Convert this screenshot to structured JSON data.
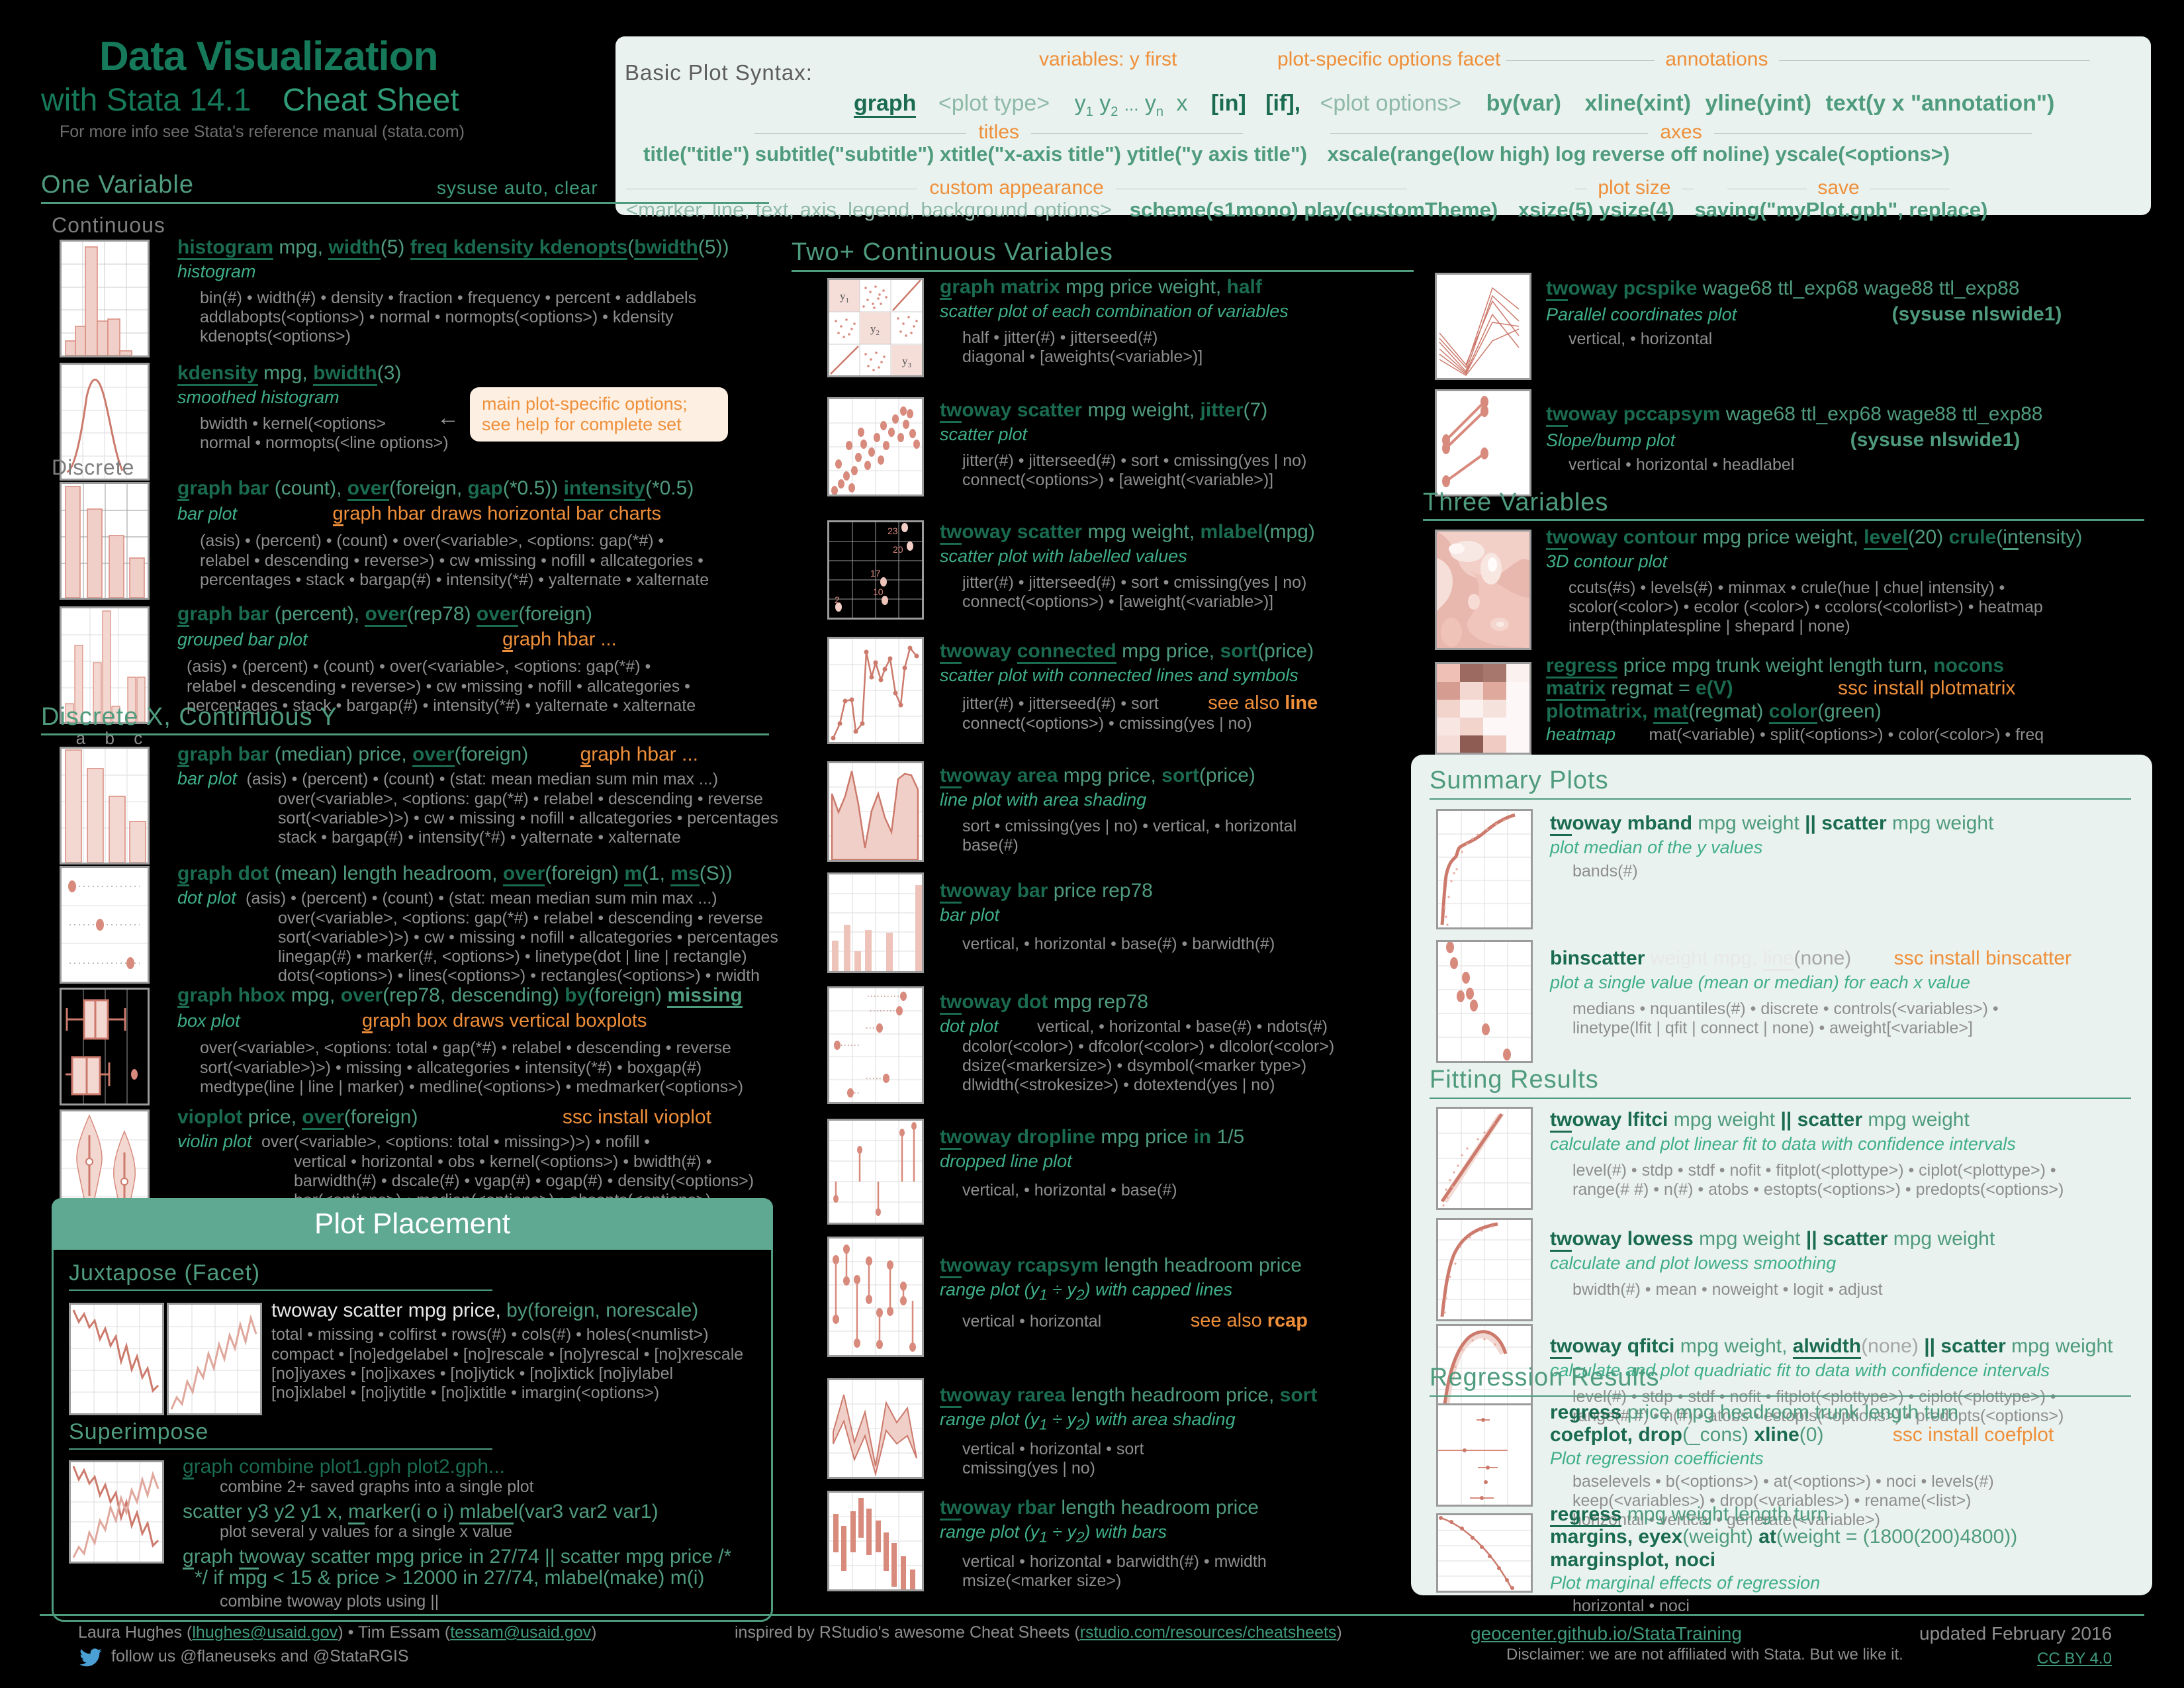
{
  "header": {
    "title": "Data Visualization",
    "subtitle_left": "with Stata 14.1",
    "subtitle_right": "Cheat Sheet",
    "note": "For more info see Stata's reference manual (stata.com)"
  },
  "syntax": {
    "label": "Basic Plot Syntax:",
    "tag_variables": "variables: y first",
    "tag_plot_opts": "plot-specific options",
    "tag_facet": "facet",
    "tag_annotations": "annotations",
    "tag_titles": "titles",
    "tag_axes": "axes",
    "tag_custom": "custom appearance",
    "tag_plotsize": "plot size",
    "tag_save": "save",
    "cmd_graph": "graph",
    "cmd_plottype": "<plot type>",
    "cmd_yvars": "y",
    "cmd_y1": "1",
    "cmd_y2": "2",
    "cmd_yn": "n",
    "cmd_x": "x",
    "cmd_in": "[in]",
    "cmd_if": "[if],",
    "cmd_plotoptions": "<plot options>",
    "cmd_by": "by(var)",
    "cmd_xline": "xline(xint)",
    "cmd_yline": "yline(yint)",
    "cmd_text": "text(y x \"annotation\")",
    "line_titles": "title(\"title\") subtitle(\"subtitle\") xtitle(\"x-axis title\") ytitle(\"y axis title\")",
    "line_axes": "xscale(range(low high) log reverse off noline) yscale(<options>)",
    "line_custom": "<marker, line, text, axis, legend, background options>",
    "line_custom2": "scheme(s1mono) play(customTheme)",
    "line_size": "xsize(5) ysize(4)",
    "line_save": "saving(\"myPlot.gph\", replace)"
  },
  "sections": {
    "one_variable": "One Variable",
    "one_variable_note": "sysuse auto, clear",
    "continuous": "Continuous",
    "discrete": "Discrete",
    "discrete_x_cont_y": "Discrete X, Continuous Y",
    "two_plus": "Two+ Continuous Variables",
    "three_variables": "Three Variables",
    "summary_plots": "Summary Plots",
    "fitting_results": "Fitting Results",
    "regression_results": "Regression Results",
    "plot_placement": "Plot Placement",
    "juxtapose": "Juxtapose (Facet)",
    "superimpose": "Superimpose"
  },
  "callout": {
    "line1": "main plot-specific options;",
    "line2": "see help for complete set"
  },
  "entries": {
    "histogram": {
      "cmd": "histogram mpg, width(5) freq kdensity kdenopts(bwidth(5))",
      "desc": "histogram",
      "opts": [
        "bin(#) • width(#) • density • fraction • frequency • percent • addlabels",
        "addlabopts(<options>) • normal • normopts(<options>) • kdensity",
        "kdenopts(<options>)"
      ]
    },
    "kdensity": {
      "cmd": "kdensity mpg, bwidth(3)",
      "desc": "smoothed histogram",
      "opts": [
        "bwidth • kernel(<options>",
        "normal • normopts(<line options>)"
      ]
    },
    "graph_bar_count": {
      "cmd": "graph bar (count), over(foreign, gap(*0.5)) intensity(*0.5)",
      "desc": "bar plot",
      "note": "graph hbar draws horizontal bar charts",
      "opts": [
        "(asis) • (percent) • (count) • over(<variable>, <options: gap(*#) •",
        "relabel • descending • reverse>) • cw •missing • nofill • allcategories •",
        "percentages • stack • bargap(#) • intensity(*#) • yalternate • xalternate"
      ]
    },
    "graph_bar_percent": {
      "cmd": "graph bar (percent), over(rep78) over(foreign)",
      "desc": "grouped bar plot",
      "note": "graph hbar ...",
      "opts": [
        "(asis) • (percent) • (count) • over(<variable>, <options: gap(*#) •",
        "relabel • descending • reverse>) • cw •missing • nofill • allcategories •",
        "percentages • stack • bargap(#) • intensity(*#) • yalternate • xalternate"
      ],
      "axis_labels": [
        "a",
        "b",
        "c"
      ]
    },
    "graph_bar_median": {
      "cmd": "graph bar (median) price, over(foreign)",
      "desc": "bar plot",
      "note": "graph hbar ...",
      "opts": [
        "(asis) • (percent) • (count) • (stat: mean median sum min max ...)",
        "over(<variable>, <options: gap(*#) • relabel • descending • reverse",
        "sort(<variable>)>) • cw • missing • nofill • allcategories • percentages",
        "stack • bargap(#) • intensity(*#) • yalternate • xalternate"
      ]
    },
    "graph_dot": {
      "cmd": "graph dot (mean) length headroom, over(foreign) m(1, ms(S))",
      "desc": "dot plot",
      "opts": [
        "(asis) • (percent) • (count) • (stat: mean median sum min max ...)",
        "over(<variable>, <options: gap(*#) • relabel • descending • reverse",
        "sort(<variable>)>) • cw • missing • nofill • allcategories • percentages",
        "linegap(#) • marker(#, <options>) • linetype(dot | line | rectangle)",
        "dots(<options>) • lines(<options>) • rectangles(<options>) • rwidth"
      ]
    },
    "graph_hbox": {
      "cmd": "graph hbox mpg, over(rep78, descending) by(foreign) missing",
      "desc": "box plot",
      "note": "graph box draws vertical boxplots",
      "opts": [
        "over(<variable>, <options: total • gap(*#) • relabel • descending • reverse",
        "sort(<variable>)>) • missing • allcategories • intensity(*#) • boxgap(#)",
        "medtype(line | line | marker) • medline(<options>) • medmarker(<options>)"
      ]
    },
    "vioplot": {
      "cmd": "vioplot price, over(foreign)",
      "desc": "violin plot",
      "note": "ssc install vioplot",
      "opts": [
        "over(<variable>, <options: total • missing>)>) • nofill •",
        "vertical • horizontal • obs • kernel(<options>) • bwidth(#) •",
        "barwidth(#) • dscale(#) • vgap(#) • ogap(#) • density(<options>)",
        "bar(<options>) • median(<options>) • obsopts(<options>)"
      ]
    },
    "graph_matrix": {
      "cmd": "graph matrix mpg price weight, half",
      "desc": "scatter plot of each combination of variables",
      "opts": [
        "half • jitter(#) • jitterseed(#)",
        "diagonal • [aweights(<variable>)]"
      ],
      "thumb_labels": [
        "y",
        "1",
        "y",
        "2",
        "y",
        "3"
      ]
    },
    "twoway_scatter": {
      "cmd": "twoway scatter mpg weight, jitter(7)",
      "desc": "scatter plot",
      "opts": [
        "jitter(#) • jitterseed(#) • sort • cmissing(yes | no)",
        "connect(<options>) • [aweight(<variable>)]"
      ]
    },
    "twoway_scatter_mlabel": {
      "cmd": "twoway scatter mpg weight, mlabel(mpg)",
      "desc": "scatter plot with labelled values",
      "opts": [
        "jitter(#) • jitterseed(#) • sort • cmissing(yes | no)",
        "connect(<options>) • [aweight(<variable>)]"
      ],
      "point_labels": [
        "23",
        "20",
        "17",
        "10",
        "2"
      ]
    },
    "twoway_connected": {
      "cmd": "twoway connected mpg price, sort(price)",
      "desc": "scatter plot with connected lines and symbols",
      "note": "see also line",
      "opts": [
        "jitter(#) • jitterseed(#) • sort",
        "connect(<options>) • cmissing(yes | no)"
      ]
    },
    "twoway_area": {
      "cmd": "twoway area mpg price, sort(price)",
      "desc": "line plot with area shading",
      "opts": [
        "sort • cmissing(yes | no) • vertical, • horizontal",
        "base(#)"
      ]
    },
    "twoway_bar": {
      "cmd": "twoway bar price rep78",
      "desc": "bar plot",
      "opts": [
        "vertical, • horizontal • base(#) • barwidth(#)"
      ]
    },
    "twoway_dot": {
      "cmd": "twoway dot mpg rep78",
      "desc": "dot plot",
      "opts": [
        "vertical, • horizontal • base(#) • ndots(#)",
        "dcolor(<color>) • dfcolor(<color>) • dlcolor(<color>)",
        "dsize(<markersize>) • dsymbol(<marker type>)",
        "dlwidth(<strokesize>) • dotextend(yes | no)"
      ]
    },
    "twoway_dropline": {
      "cmd": "twoway dropline mpg price in 1/5",
      "desc": "dropped line plot",
      "opts": [
        "vertical, • horizontal • base(#)"
      ]
    },
    "twoway_rcapsym": {
      "cmd": "twoway rcapsym length headroom price",
      "desc": "range plot (y1 ÷ y2) with capped lines",
      "note": "see also rcap",
      "opts": [
        "vertical • horizontal"
      ]
    },
    "twoway_rarea": {
      "cmd": "twoway rarea length headroom price, sort",
      "desc": "range plot (y1 ÷ y2) with area shading",
      "opts": [
        "vertical • horizontal • sort",
        "cmissing(yes | no)"
      ]
    },
    "twoway_rbar": {
      "cmd": "twoway rbar length headroom price",
      "desc": "range plot (y1 ÷ y2) with bars",
      "opts": [
        "vertical • horizontal • barwidth(#) • mwidth",
        "msize(<marker size>)"
      ]
    },
    "twoway_pcspike": {
      "cmd": "twoway pcspike wage68 ttl_exp68 wage88 ttl_exp88",
      "desc": "Parallel coordinates plot",
      "note": "(sysuse nlswide1)",
      "opts": [
        "vertical, • horizontal"
      ]
    },
    "twoway_pccapsym": {
      "cmd": "twoway pccapsym wage68 ttl_exp68 wage88 ttl_exp88",
      "desc": "Slope/bump plot",
      "note": "(sysuse nlswide1)",
      "opts": [
        "vertical • horizontal • headlabel"
      ]
    },
    "twoway_contour": {
      "cmd": "twoway contour mpg price weight, level(20) crule(intensity)",
      "desc": "3D contour plot",
      "opts": [
        "ccuts(#s) • levels(#) • minmax • crule(hue | chue| intensity) •",
        "scolor(<color>) • ecolor (<color>) • ccolors(<colorlist>) • heatmap",
        "interp(thinplatespline | shepard | none)"
      ]
    },
    "plotmatrix": {
      "cmd1": "regress price mpg trunk weight length turn, nocons",
      "cmd2": "matrix regmat = e(V)",
      "cmd3": "plotmatrix, mat(regmat) color(green)",
      "desc": "heatmap",
      "note": "ssc install plotmatrix",
      "opts": [
        "mat(<variable) • split(<options>) • color(<color>) • freq"
      ]
    },
    "twoway_mband": {
      "cmd": "twoway mband mpg weight || scatter mpg weight",
      "desc": "plot median of the y values",
      "opts": [
        "bands(#)"
      ]
    },
    "binscatter": {
      "cmd": "binscatter weight mpg, line(none)",
      "desc": "plot a single value (mean or median) for each x value",
      "note": "ssc install binscatter",
      "opts": [
        "medians • nquantiles(#) • discrete • controls(<variables>) •",
        "linetype(lfit | qfit | connect | none) • aweight[<variable>]"
      ]
    },
    "twoway_lfitci": {
      "cmd": "twoway lfitci mpg weight || scatter mpg weight",
      "desc": "calculate and plot linear fit to data with confidence intervals",
      "opts": [
        "level(#) • stdp • stdf • nofit • fitplot(<plottype>) • ciplot(<plottype>) •",
        "range(# #) • n(#) • atobs • estopts(<options>) • predopts(<options>)"
      ]
    },
    "twoway_lowess": {
      "cmd": "twoway lowess mpg weight || scatter mpg weight",
      "desc": "calculate and plot lowess smoothing",
      "opts": [
        "bwidth(#) • mean • noweight • logit • adjust"
      ]
    },
    "twoway_qfitci": {
      "cmd": "twoway qfitci mpg weight, alwidth(none) || scatter mpg weight",
      "desc": "calculate and plot quadriatic fit to data with confidence intervals",
      "opts": [
        "level(#) • stdp • stdf • nofit • fitplot(<plottype>) • ciplot(<plottype>) •",
        "range(# #) • n(#) • atobs • estopts(<options>) • predopts(<options>)"
      ]
    },
    "coefplot": {
      "cmd1": "regress price mpg headroom trunk length turn",
      "cmd2": "coefplot, drop(_cons) xline(0)",
      "desc": "Plot regression coefficients",
      "note": "ssc install coefplot",
      "opts": [
        "baselevels • b(<options>) • at(<options>) • noci • levels(#)",
        "keep(<variables>) • drop(<variables>)  • rename(<list>)",
        "horizontal • vertical • generate(<variable>)"
      ]
    },
    "marginsplot": {
      "cmd1": "regress mpg weight length turn",
      "cmd2": "margins, eyex(weight) at(weight = (1800(200)4800))",
      "cmd3": "marginsplot, noci",
      "desc": "Plot marginal effects of regression",
      "opts": [
        "horizontal • noci"
      ]
    },
    "facet": {
      "cmd": "twoway scatter mpg price, by(foreign, norescale)",
      "opts": [
        "total • missing • colfirst • rows(#) • cols(#) • holes(<numlist>)",
        "compact • [no]edgelabel • [no]rescale • [no]yrescal • [no]xrescale",
        "[no]iyaxes • [no]ixaxes • [no]iytick • [no]ixtick [no]iylabel",
        "[no]ixlabel • [no]iytitle • [no]ixtitle • imargin(<options>)"
      ]
    },
    "combine": {
      "cmd": "graph combine plot1.gph plot2.gph...",
      "desc": "combine 2+ saved graphs into a single plot"
    },
    "scatter_multi": {
      "cmd": "scatter y3 y2 y1 x, marker(i o i) mlabel(var3 var2 var1)",
      "desc": "plot several y values for a single x value"
    },
    "twoway_combine": {
      "cmd1": "graph twoway scatter mpg price in 27/74 || scatter mpg price /*",
      "cmd2": "*/ if mpg < 15  & price > 12000 in 27/74, mlabel(make) m(i)",
      "desc": "combine twoway plots using ||"
    }
  },
  "footer": {
    "authors": "Laura Hughes (lhughes@usaid.gov) • Tim Essam (tessam@usaid.gov)",
    "inspired": "inspired by RStudio's awesome Cheat Sheets (rstudio.com/resources/cheatsheets)",
    "site": "geocenter.github.io/StataTraining",
    "updated": "updated February 2016",
    "follow": "follow us @flaneuseks and @StataRGIS",
    "disclaimer": "Disclaimer: we are not affiliated with Stata. But we like it.",
    "license": "CC BY 4.0"
  },
  "colors": {
    "background": "#000000",
    "green_dark": "#15795a",
    "green_mid": "#4f9b7e",
    "mint": "#3fae8a",
    "orange": "#ef8f3a",
    "panel_bg": "#e9f2ee",
    "salmon": "#d88a7d"
  }
}
